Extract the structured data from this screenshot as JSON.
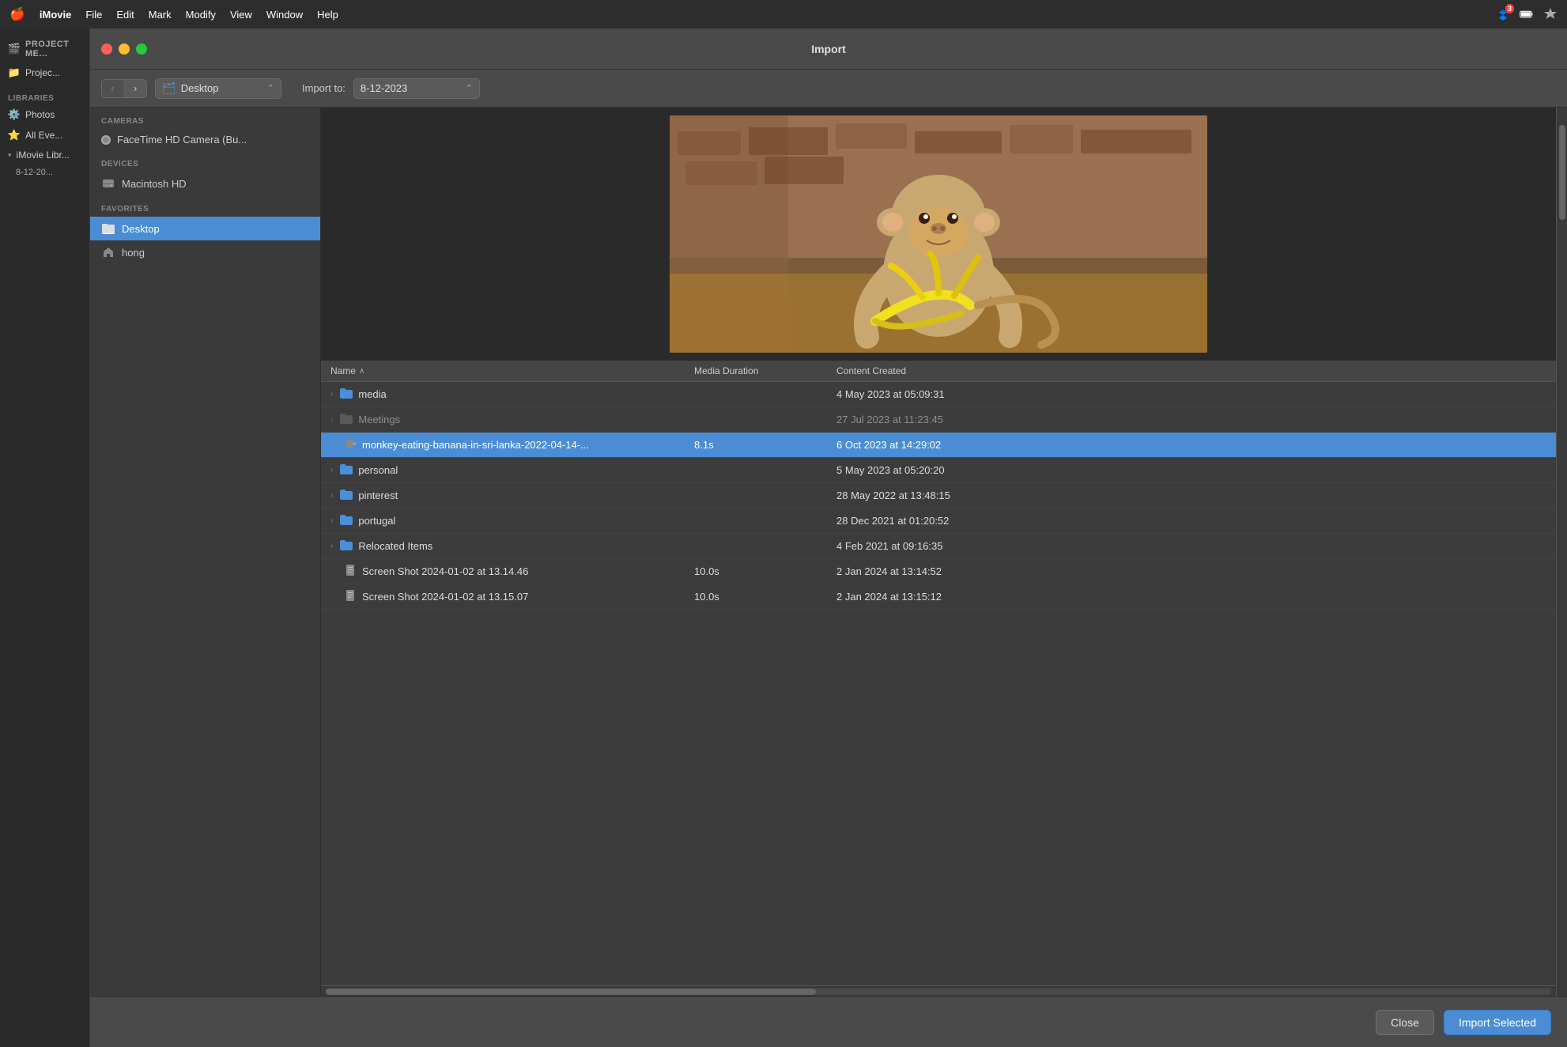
{
  "menubar": {
    "apple": "🍎",
    "items": [
      {
        "label": "iMovie",
        "bold": true
      },
      {
        "label": "File"
      },
      {
        "label": "Edit"
      },
      {
        "label": "Mark"
      },
      {
        "label": "Modify"
      },
      {
        "label": "View"
      },
      {
        "label": "Window"
      },
      {
        "label": "Help"
      }
    ],
    "right_icons": [
      {
        "name": "dropbox-icon",
        "badge": "3"
      },
      {
        "name": "battery-icon"
      },
      {
        "name": "extension-icon"
      }
    ]
  },
  "imovie_sidebar": {
    "project_label": "PROJECT ME...",
    "project_icon": "🎬",
    "project_name": "Projec...",
    "libraries_section": "LIBRARIES",
    "lib_items": [
      {
        "label": "Photos",
        "icon": "⚙️"
      },
      {
        "label": "All Eve...",
        "icon": "⭐"
      },
      {
        "label": "iMovie Libr...",
        "arrow": "▾",
        "expanded": true
      },
      {
        "label": "8-12-20...",
        "indent": true
      }
    ]
  },
  "dialog": {
    "title": "Import",
    "toolbar": {
      "back_button": "‹",
      "forward_button": "›",
      "location": "Desktop",
      "import_to_label": "Import to:",
      "import_to_value": "8-12-2023",
      "chevron": "⌃"
    },
    "file_sidebar": {
      "cameras_section": "CAMERAS",
      "cameras": [
        {
          "label": "FaceTime HD Camera (Bu..."
        }
      ],
      "devices_section": "DEVICES",
      "devices": [
        {
          "label": "Macintosh HD",
          "icon": "💾"
        }
      ],
      "favorites_section": "FAVORITES",
      "favorites": [
        {
          "label": "Desktop",
          "selected": true
        },
        {
          "label": "hong"
        }
      ]
    },
    "columns": {
      "name": "Name",
      "sort_arrow": "∧",
      "media_duration": "Media Duration",
      "content_created": "Content Created"
    },
    "files": [
      {
        "type": "folder",
        "name": "media",
        "duration": "",
        "created": "4 May 2023 at 05:09:31",
        "expandable": true,
        "disabled": false
      },
      {
        "type": "folder-gray",
        "name": "Meetings",
        "duration": "",
        "created": "27 Jul 2023 at 11:23:45",
        "expandable": true,
        "disabled": true
      },
      {
        "type": "video",
        "name": "monkey-eating-banana-in-sri-lanka-2022-04-14-...",
        "duration": "8.1s",
        "created": "6 Oct 2023 at 14:29:02",
        "expandable": false,
        "disabled": false,
        "selected": true
      },
      {
        "type": "folder",
        "name": "personal",
        "duration": "",
        "created": "5 May 2023 at 05:20:20",
        "expandable": true,
        "disabled": false
      },
      {
        "type": "folder",
        "name": "pinterest",
        "duration": "",
        "created": "28 May 2022 at 13:48:15",
        "expandable": true,
        "disabled": false
      },
      {
        "type": "folder",
        "name": "portugal",
        "duration": "",
        "created": "28 Dec 2021 at 01:20:52",
        "expandable": true,
        "disabled": false
      },
      {
        "type": "folder",
        "name": "Relocated Items",
        "duration": "",
        "created": "4 Feb 2021 at 09:16:35",
        "expandable": true,
        "disabled": false
      },
      {
        "type": "file",
        "name": "Screen Shot 2024-01-02 at 13.14.46",
        "duration": "10.0s",
        "created": "2 Jan 2024 at 13:14:52",
        "expandable": false,
        "disabled": false
      },
      {
        "type": "file",
        "name": "Screen Shot 2024-01-02 at 13.15.07",
        "duration": "10.0s",
        "created": "2 Jan 2024 at 13:15:12",
        "expandable": false,
        "disabled": false
      }
    ],
    "footer": {
      "close_label": "Close",
      "import_label": "Import Selected"
    }
  }
}
